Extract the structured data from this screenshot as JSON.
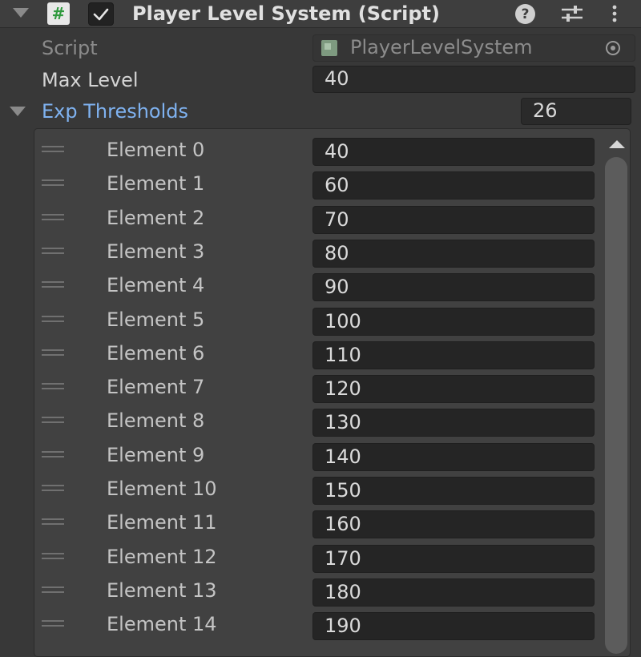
{
  "header": {
    "title": "Player Level System (Script)",
    "script_icon_glyph": "#",
    "help_glyph": "?"
  },
  "properties": {
    "script_label": "Script",
    "script_value": "PlayerLevelSystem",
    "max_level_label": "Max Level",
    "max_level_value": "40",
    "exp_thresholds_label": "Exp Thresholds",
    "exp_thresholds_size": "26"
  },
  "exp_thresholds": [
    {
      "label": "Element 0",
      "value": "40"
    },
    {
      "label": "Element 1",
      "value": "60"
    },
    {
      "label": "Element 2",
      "value": "70"
    },
    {
      "label": "Element 3",
      "value": "80"
    },
    {
      "label": "Element 4",
      "value": "90"
    },
    {
      "label": "Element 5",
      "value": "100"
    },
    {
      "label": "Element 6",
      "value": "110"
    },
    {
      "label": "Element 7",
      "value": "120"
    },
    {
      "label": "Element 8",
      "value": "130"
    },
    {
      "label": "Element 9",
      "value": "140"
    },
    {
      "label": "Element 10",
      "value": "150"
    },
    {
      "label": "Element 11",
      "value": "160"
    },
    {
      "label": "Element 12",
      "value": "170"
    },
    {
      "label": "Element 13",
      "value": "180"
    },
    {
      "label": "Element 14",
      "value": "190"
    }
  ],
  "colors": {
    "background": "#383838",
    "link_blue": "#7fb2f0",
    "script_green": "#2f9a3e"
  },
  "icons": [
    "foldout-arrow-icon",
    "csharp-script-icon",
    "checkmark-icon",
    "help-icon",
    "presets-icon",
    "kebab-menu-icon",
    "object-picker-icon",
    "drag-handle-icon",
    "scroll-up-arrow-icon"
  ]
}
